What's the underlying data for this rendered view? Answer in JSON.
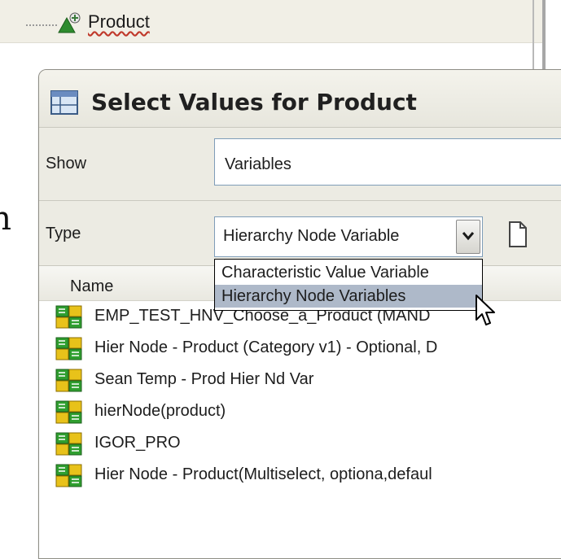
{
  "tree": {
    "node_label": "Product"
  },
  "dialog": {
    "title": "Select Values for Product",
    "show_label": "Show",
    "show_value": "Variables",
    "type_label": "Type",
    "type_value": "Hierarchy Node Variable",
    "type_options": [
      "Characteristic Value Variable",
      "Hierarchy Node Variables"
    ],
    "list_header": "Name",
    "variables": [
      "EMP_TEST_HNV_Choose_a_Product (MAND",
      "Hier Node - Product (Category v1) - Optional, D",
      "Sean Temp - Prod Hier Nd Var",
      "hierNode(product)",
      "IGOR_PRO",
      "Hier Node - Product(Multiselect, optiona,defaul"
    ]
  },
  "background_fragment": "n",
  "colors": {
    "highlight": "#aeb9c9",
    "dialog_bg": "#ecebe3",
    "input_border": "#7f9db9"
  },
  "icons": [
    "hierarchy-product-icon",
    "table-grid-icon",
    "chevron-down-icon",
    "page-icon",
    "variable-icon",
    "mouse-cursor-icon"
  ]
}
